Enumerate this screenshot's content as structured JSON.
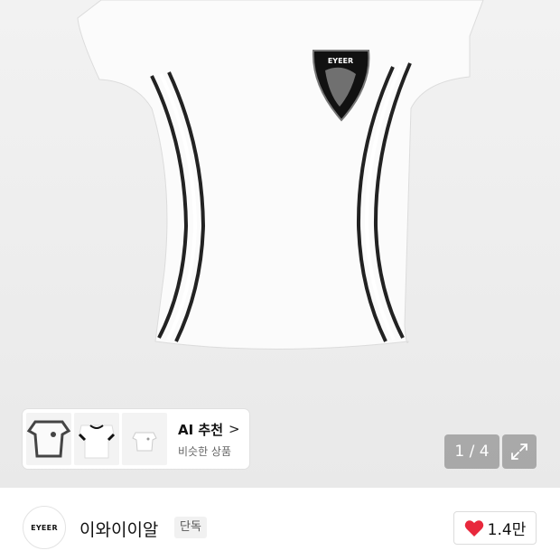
{
  "gallery": {
    "pager_text": "1 / 4"
  },
  "ai_recommend": {
    "title": "AI 추천",
    "chevron": ">",
    "subtitle": "비슷한 상품"
  },
  "brand": {
    "logo_text": "EYEER",
    "name": "이와이이알",
    "badge": "단독"
  },
  "like": {
    "count": "1.4만",
    "icon": "heart-icon",
    "color": "#e8283c"
  },
  "product": {
    "emblem_text": "EYEER"
  }
}
